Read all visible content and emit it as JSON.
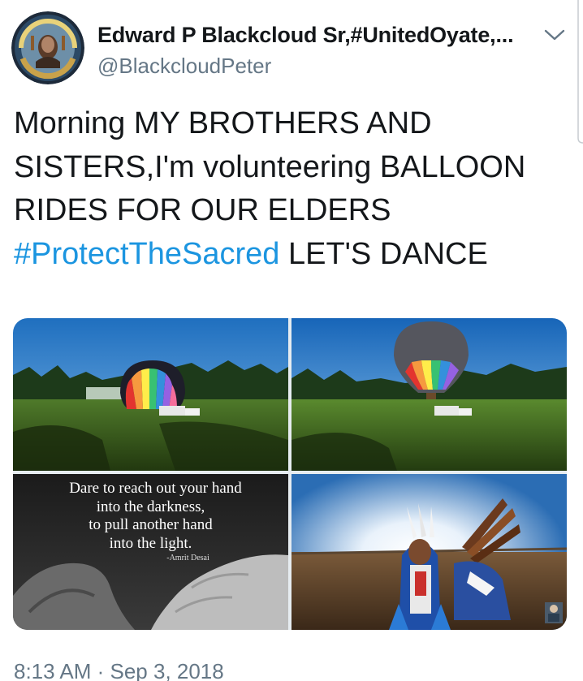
{
  "author": {
    "display_name": "Edward P Blackcloud Sr,#UnitedOyate,...",
    "handle": "@BlackcloudPeter",
    "avatar_icon": "profile-avatar"
  },
  "menu_icon": "chevron-down-icon",
  "tweet": {
    "lines": [
      "Morning MY BROTHERS AND",
      "SISTERS,I'm volunteering  BALLOON",
      "RIDES FOR OUR ELDERS"
    ],
    "hashtag": "#ProtectTheSacred",
    "line4_rest": " LET'S DANCE"
  },
  "media": {
    "quote_lines": [
      "Dare to reach out your hand",
      "into the darkness,",
      "to pull another hand",
      "into the light."
    ],
    "quote_author": "-Amrit Desai",
    "images": [
      "balloon-inflating-photo",
      "balloon-rising-photo",
      "quote-hands-photo",
      "dancer-photo"
    ]
  },
  "timestamp": "8:13 AM · Sep 3, 2018",
  "colors": {
    "hashtag": "#1b95e0",
    "secondary_text": "#657786",
    "text": "#14171a"
  }
}
